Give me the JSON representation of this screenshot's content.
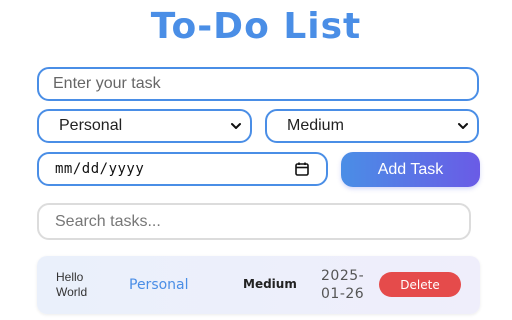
{
  "title": "To-Do List",
  "task_input": {
    "placeholder": "Enter your task"
  },
  "category_select": {
    "selected": "Personal",
    "icon": "chevron-down-icon"
  },
  "priority_select": {
    "selected": "Medium",
    "icon": "chevron-down-icon"
  },
  "date_input": {
    "placeholder": "mm/dd/yyyy",
    "icon": "calendar-icon"
  },
  "add_button": {
    "label": "Add Task"
  },
  "search": {
    "placeholder": "Search tasks..."
  },
  "tasks": [
    {
      "name_line1": "Hello",
      "name_line2": "World",
      "category": "Personal",
      "priority": "Medium",
      "date_line1": "2025-",
      "date_line2": "01-26",
      "delete_label": "Delete"
    }
  ],
  "colors": {
    "accent": "#4a8ee6",
    "accent_gradient_end": "#6a5be6",
    "delete": "#e54b4b"
  }
}
